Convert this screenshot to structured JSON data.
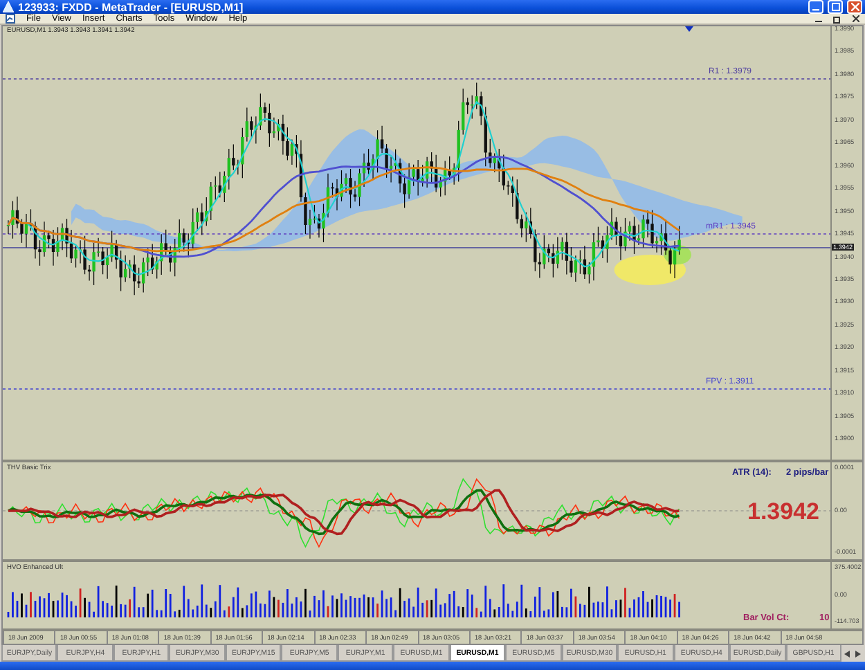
{
  "window": {
    "title": "123933: FXDD - MetaTrader - [EURUSD,M1]"
  },
  "menu": [
    "File",
    "View",
    "Insert",
    "Charts",
    "Tools",
    "Window",
    "Help"
  ],
  "chart": {
    "header": "EURUSD,M1  1.3943 1.3943 1.3941 1.3942",
    "current_price": "1.3942",
    "price_axis": [
      "1.3990",
      "1.3985",
      "1.3980",
      "1.3975",
      "1.3970",
      "1.3965",
      "1.3960",
      "1.3955",
      "1.3950",
      "1.3945",
      "1.3940",
      "1.3935",
      "1.3930",
      "1.3925",
      "1.3920",
      "1.3915",
      "1.3910",
      "1.3905",
      "1.3900"
    ],
    "levels": [
      {
        "label": "R1 : 1.3979",
        "kind": "resistance"
      },
      {
        "label": "mR1 : 1.3945",
        "kind": "mid"
      },
      {
        "label": "FPV : 1.3911",
        "kind": "pivot"
      }
    ]
  },
  "indicators": [
    {
      "kind": "trix",
      "title": "THV Basic Trix",
      "axis": [
        "0.0001",
        "0.00",
        "-0.0001"
      ],
      "readout_label": "ATR (14):",
      "readout_value": "2 pips/bar",
      "big_price": "1.3942"
    },
    {
      "kind": "volume",
      "title": "HVO Enhanced Ult",
      "axis": [
        "375.4002",
        "0.00",
        "-114.703"
      ],
      "readout_label": "Bar Vol Ct:",
      "readout_value": "10"
    }
  ],
  "time_axis": [
    "18 Jun 2009",
    "18 Jun 00:55",
    "18 Jun 01:08",
    "18 Jun 01:39",
    "18 Jun 01:56",
    "18 Jun 02:14",
    "18 Jun 02:33",
    "18 Jun 02:49",
    "18 Jun 03:05",
    "18 Jun 03:21",
    "18 Jun 03:37",
    "18 Jun 03:54",
    "18 Jun 04:10",
    "18 Jun 04:26",
    "18 Jun 04:42",
    "18 Jun 04:58"
  ],
  "tabs": [
    {
      "label": "EURJPY,Daily",
      "selected": false
    },
    {
      "label": "EURJPY,H4",
      "selected": false
    },
    {
      "label": "EURJPY,H1",
      "selected": false
    },
    {
      "label": "EURJPY,M30",
      "selected": false
    },
    {
      "label": "EURJPY,M15",
      "selected": false
    },
    {
      "label": "EURJPY,M5",
      "selected": false
    },
    {
      "label": "EURJPY,M1",
      "selected": false
    },
    {
      "label": "EURUSD,M1",
      "selected": false
    },
    {
      "label": "EURUSD,M1",
      "selected": true
    },
    {
      "label": "EURUSD,M5",
      "selected": false
    },
    {
      "label": "EURUSD,M30",
      "selected": false
    },
    {
      "label": "EURUSD,H1",
      "selected": false
    },
    {
      "label": "EURUSD,H4",
      "selected": false
    },
    {
      "label": "EURUSD,Daily",
      "selected": false
    },
    {
      "label": "GBPUSD,H1",
      "selected": false
    }
  ]
}
